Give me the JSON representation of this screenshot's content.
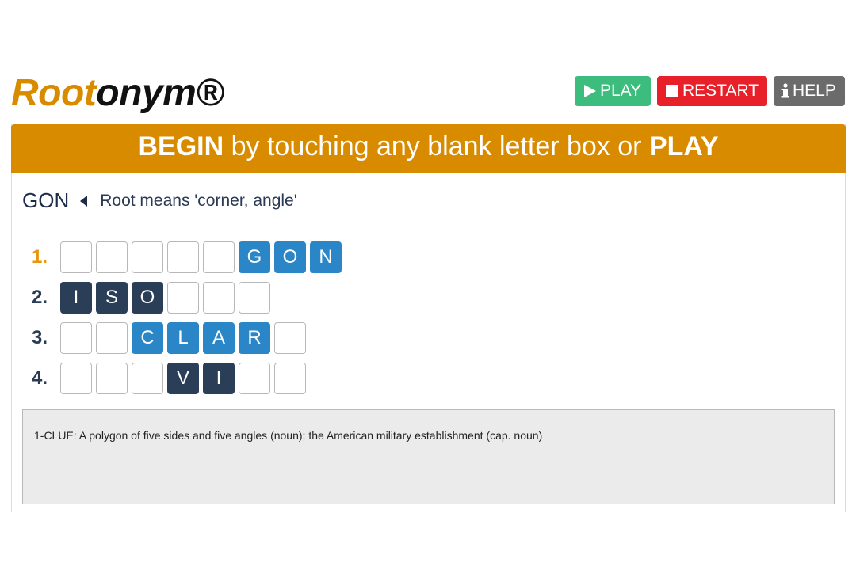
{
  "app": {
    "logo_part1": "Root",
    "logo_part2": "onym®"
  },
  "toolbar": {
    "play_label": "PLAY",
    "restart_label": "RESTART",
    "help_label": "HELP"
  },
  "banner": {
    "bold1": "BEGIN",
    "middle": " by touching any blank letter box or ",
    "bold2": "PLAY"
  },
  "root": {
    "word": "GON",
    "meaning": "Root means 'corner, angle'"
  },
  "rows": [
    {
      "number": "1.",
      "active": true,
      "cells": [
        [
          "",
          ""
        ],
        [
          "",
          ""
        ],
        [
          "",
          ""
        ],
        [
          "",
          ""
        ],
        [
          "",
          ""
        ],
        [
          "G",
          "root"
        ],
        [
          "O",
          "root"
        ],
        [
          "N",
          "root"
        ]
      ]
    },
    {
      "number": "2.",
      "active": false,
      "cells": [
        [
          "I",
          "dark"
        ],
        [
          "S",
          "dark"
        ],
        [
          "O",
          "dark"
        ],
        [
          "",
          ""
        ],
        [
          "",
          ""
        ],
        [
          "",
          ""
        ]
      ]
    },
    {
      "number": "3.",
      "active": false,
      "cells": [
        [
          "",
          ""
        ],
        [
          "",
          ""
        ],
        [
          "C",
          "root"
        ],
        [
          "L",
          "root"
        ],
        [
          "A",
          "root"
        ],
        [
          "R",
          "root"
        ],
        [
          "",
          ""
        ]
      ]
    },
    {
      "number": "4.",
      "active": false,
      "cells": [
        [
          "",
          ""
        ],
        [
          "",
          ""
        ],
        [
          "",
          ""
        ],
        [
          "V",
          "dark"
        ],
        [
          "I",
          "dark"
        ],
        [
          "",
          ""
        ],
        [
          "",
          ""
        ]
      ]
    }
  ],
  "clue": {
    "text": "1-CLUE: A polygon of five sides and five angles (noun); the American military establishment (cap. noun)"
  },
  "colors": {
    "accent": "#d98b00",
    "play": "#3dbd7d",
    "restart": "#e8202a",
    "help": "#6b6b6b",
    "root_cell": "#2a86c6",
    "dark_cell": "#2a3e57"
  }
}
